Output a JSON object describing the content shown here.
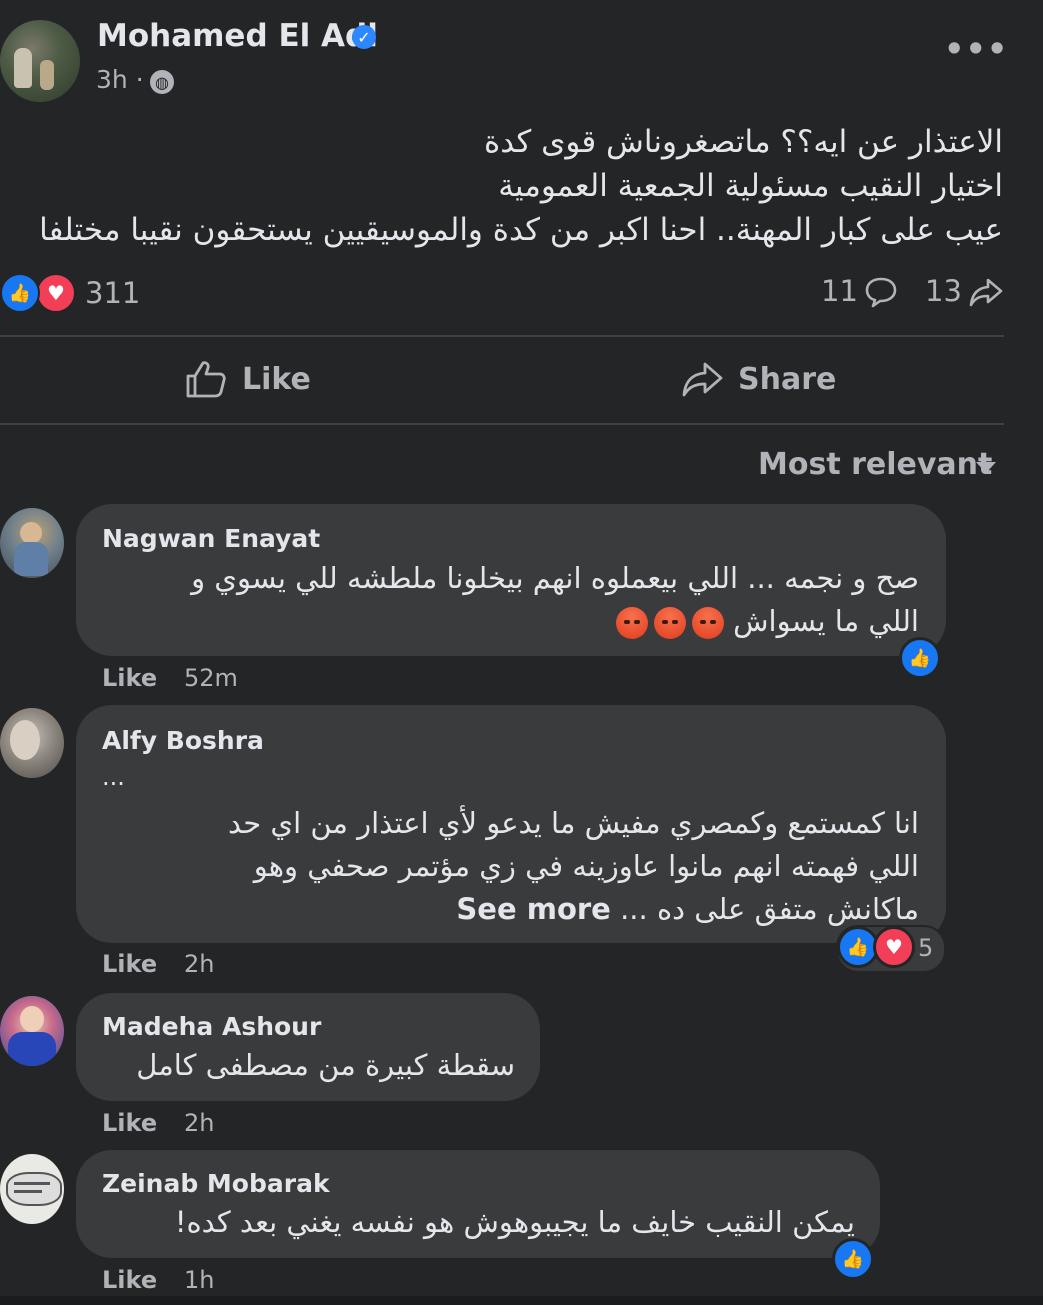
{
  "post": {
    "author": "Mohamed El Adl",
    "verified_icon": "verified-badge-icon",
    "time": "3h ·",
    "audience_icon": "globe-icon",
    "text_lines": [
      "الاعتذار عن ايه؟؟ ماتصغروناش قوى كدة",
      "اختيار النقيب مسئولية الجمعية العمومية",
      "عيب على كبار المهنة.. احنا اكبر من كدة والموسيقيين يستحقون نقيبا مختلفا"
    ],
    "reaction_count": "311",
    "comments_count": "11",
    "shares_count": "13",
    "like_label": "Like",
    "share_label": "Share"
  },
  "sort_label": "Most relevant",
  "comments": [
    {
      "name": "Nagwan Enayat",
      "lines": [
        "صح و نجمه ... اللي بيعملوه انهم بيخلونا ملطشه للي يسوي و",
        "اللي ما يسواش"
      ],
      "emoji_count": 3,
      "like_label": "Like",
      "time": "52m"
    },
    {
      "name": "Alfy Boshra",
      "lines": [
        "...",
        "انا كمستمع وكمصري مفيش ما يدعو لأي اعتذار من اي حد",
        "اللي فهمته انهم مانوا عاوزينه في زي مؤتمر صحفي وهو",
        "ماكانش متفق على ده ..."
      ],
      "see_more": "See more",
      "reaction_count": "5",
      "like_label": "Like",
      "time": "2h"
    },
    {
      "name": "Madeha Ashour",
      "lines": [
        "سقطة كبيرة من مصطفى كامل"
      ],
      "like_label": "Like",
      "time": "2h"
    },
    {
      "name": "Zeinab Mobarak",
      "lines": [
        "يمكن النقيب خايف ما يجيبوهوش هو نفسه يغني بعد كده!"
      ],
      "like_label": "Like",
      "time": "1h"
    }
  ],
  "colors": {
    "background": "#242526",
    "bubble": "#3a3b3c",
    "accent_blue": "#1877f2",
    "love_red": "#f33e58",
    "secondary_text": "#b0b3b8"
  }
}
